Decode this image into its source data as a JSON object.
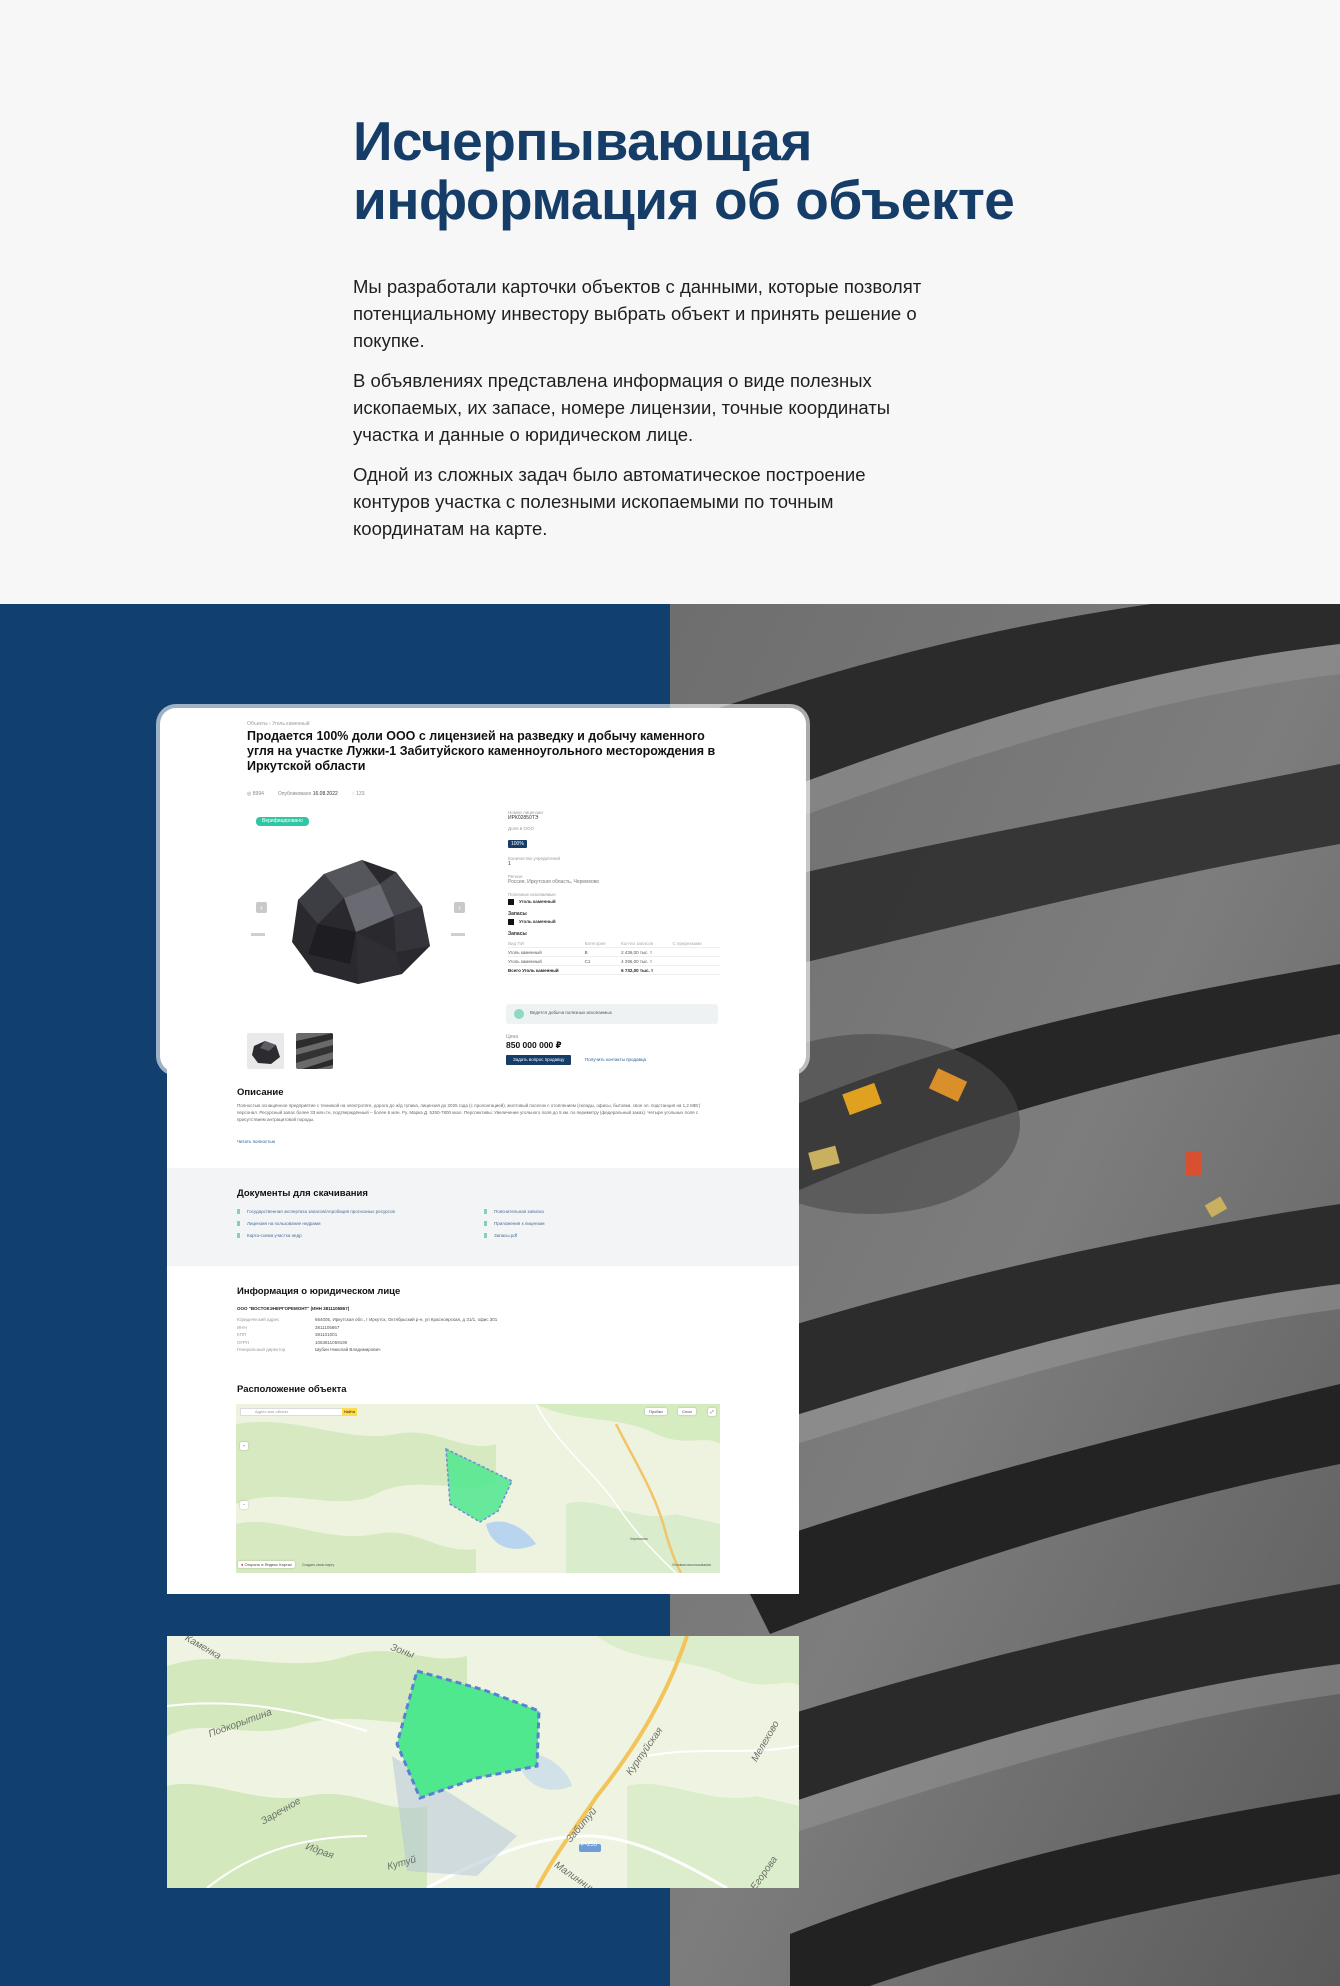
{
  "intro": {
    "title_line1": "Исчерпывающая",
    "title_line2": "информация об объекте",
    "paragraphs": [
      "Мы разработали карточки объектов с данными, которые позволят потенциальному инвестору выбрать объект и принять решение о покупке.",
      "В объявлениях представлена информация о виде полезных ископаемых, их запасе, номере лицензии, точные координаты участка и данные о юридическом лице.",
      "Одной из сложных задач было автоматическое построение контуров участка с полезными ископаемыми по точным координатам на карте."
    ]
  },
  "colors": {
    "navy": "#11406e",
    "title": "#153d67",
    "accent_green": "#2ec6a3",
    "polygon_fill": "#4fe88f",
    "polygon_stroke": "#5b7fd6"
  },
  "card": {
    "breadcrumb": "Объекты  ›  Уголь каменный",
    "title": "Продается 100% доли ООО с лицензией на разведку и добычу каменного угля на участке Лужки-1 Забитуйского каменноугольного месторождения в Иркутской области",
    "meta": {
      "views": "8994",
      "published_label": "Опубликовано",
      "published": "16.08.2022",
      "id": "133"
    },
    "verified": "Верифицировано",
    "info": {
      "license_label": "Номер лицензии",
      "license": "ИРК02850ТЭ",
      "share_label": "Доля в ООО",
      "share": "100%",
      "founders_label": "Количество учредителей",
      "founders": "1",
      "region_label": "Регион",
      "region": "Россия, Иркутская область, Черемхово",
      "minerals_label": "Полезные ископаемые",
      "mineral": "Уголь каменный",
      "reserves_label": "Запасы",
      "reserves_mineral": "Уголь каменный",
      "table_title": "Запасы",
      "table_headers": [
        "Вид ПИ",
        "Категория",
        "Кол-во запасов",
        "С прирезками"
      ],
      "table_rows": [
        [
          "Уголь каменный",
          "B",
          "2 436,00 тыс. т",
          ""
        ],
        [
          "Уголь каменный",
          "C1",
          "4 296,00 тыс. т",
          ""
        ],
        [
          "Всего Уголь каменный",
          "",
          "6 732,00 тыс. т",
          ""
        ]
      ],
      "notice": "Ведется добыча полезных ископаемых",
      "price_label": "Цена",
      "price": "850 000 000 ₽",
      "btn_primary": "Задать вопрос продавцу",
      "btn_link": "Получить контакты продавца"
    },
    "description": {
      "title": "Описание",
      "text": "Полностью оснащённое предприятие с техникой на электротяге, дорога до ж/д тупика, лицензия до 2025 года (с пролонгацией), жилтовый поселок с отоплением (склады, офисы, бытовки, свое эл. подстанция на 1,2 МВт) персонал. Ресурсный запас более 33 млн.тн, подтверждённый – более 6 млн. Ру. Марка Д. 5250-7800 ккал. Перспективы: Увеличение угольного поля до 5 км. по периметру (федеральный заказ). Четыре угольных поля с присутствием антрацитовой породы.",
      "read_more": "Читать полностью"
    },
    "documents": {
      "title": "Документы для скачивания",
      "items": [
        "Государственная экспертиза запасов/Апробация прогнозных ресурсов",
        "Пояснительная записка",
        "Лицензия на пользование недрами",
        "Приложения к лицензии",
        "Карта-схема участка недр",
        "Запасы.pdf"
      ]
    },
    "legal": {
      "title": "Информация о юридическом лице",
      "company": "ООО \"ВОСТОКЭНЕРГОРЕМОНТ\" (ИНН 3811105867)",
      "rows": [
        [
          "Юридический адрес",
          "664005, Иркутская обл., г Иркутск, Октябрьский р-н, ул Красноярская, д 31/1, офис 301"
        ],
        [
          "ИНН",
          "3811105867"
        ],
        [
          "КПП",
          "381101001"
        ],
        [
          "ОГРН",
          "1063811059190"
        ],
        [
          "Генеральный директор",
          "Шубин Николай Владимирович"
        ]
      ]
    },
    "location": {
      "title": "Расположение объекта",
      "search_placeholder": "Адрес или объект",
      "search_button": "Найти",
      "traffic": "Пробки",
      "layers": "Слои",
      "open_in_maps": "Открыть в Яндекс Картах",
      "create_map": "Создать свою карту",
      "terms": "Условия использования",
      "town": "Черемхово"
    }
  },
  "big_map": {
    "labels": [
      "Каменка",
      "Зоны",
      "Подкорытина",
      "Мелехово",
      "Куртуйская",
      "Заречное",
      "Идрая",
      "Кутуй",
      "Забитуй",
      "Малинник",
      "Егорова",
      "Р-255"
    ]
  }
}
